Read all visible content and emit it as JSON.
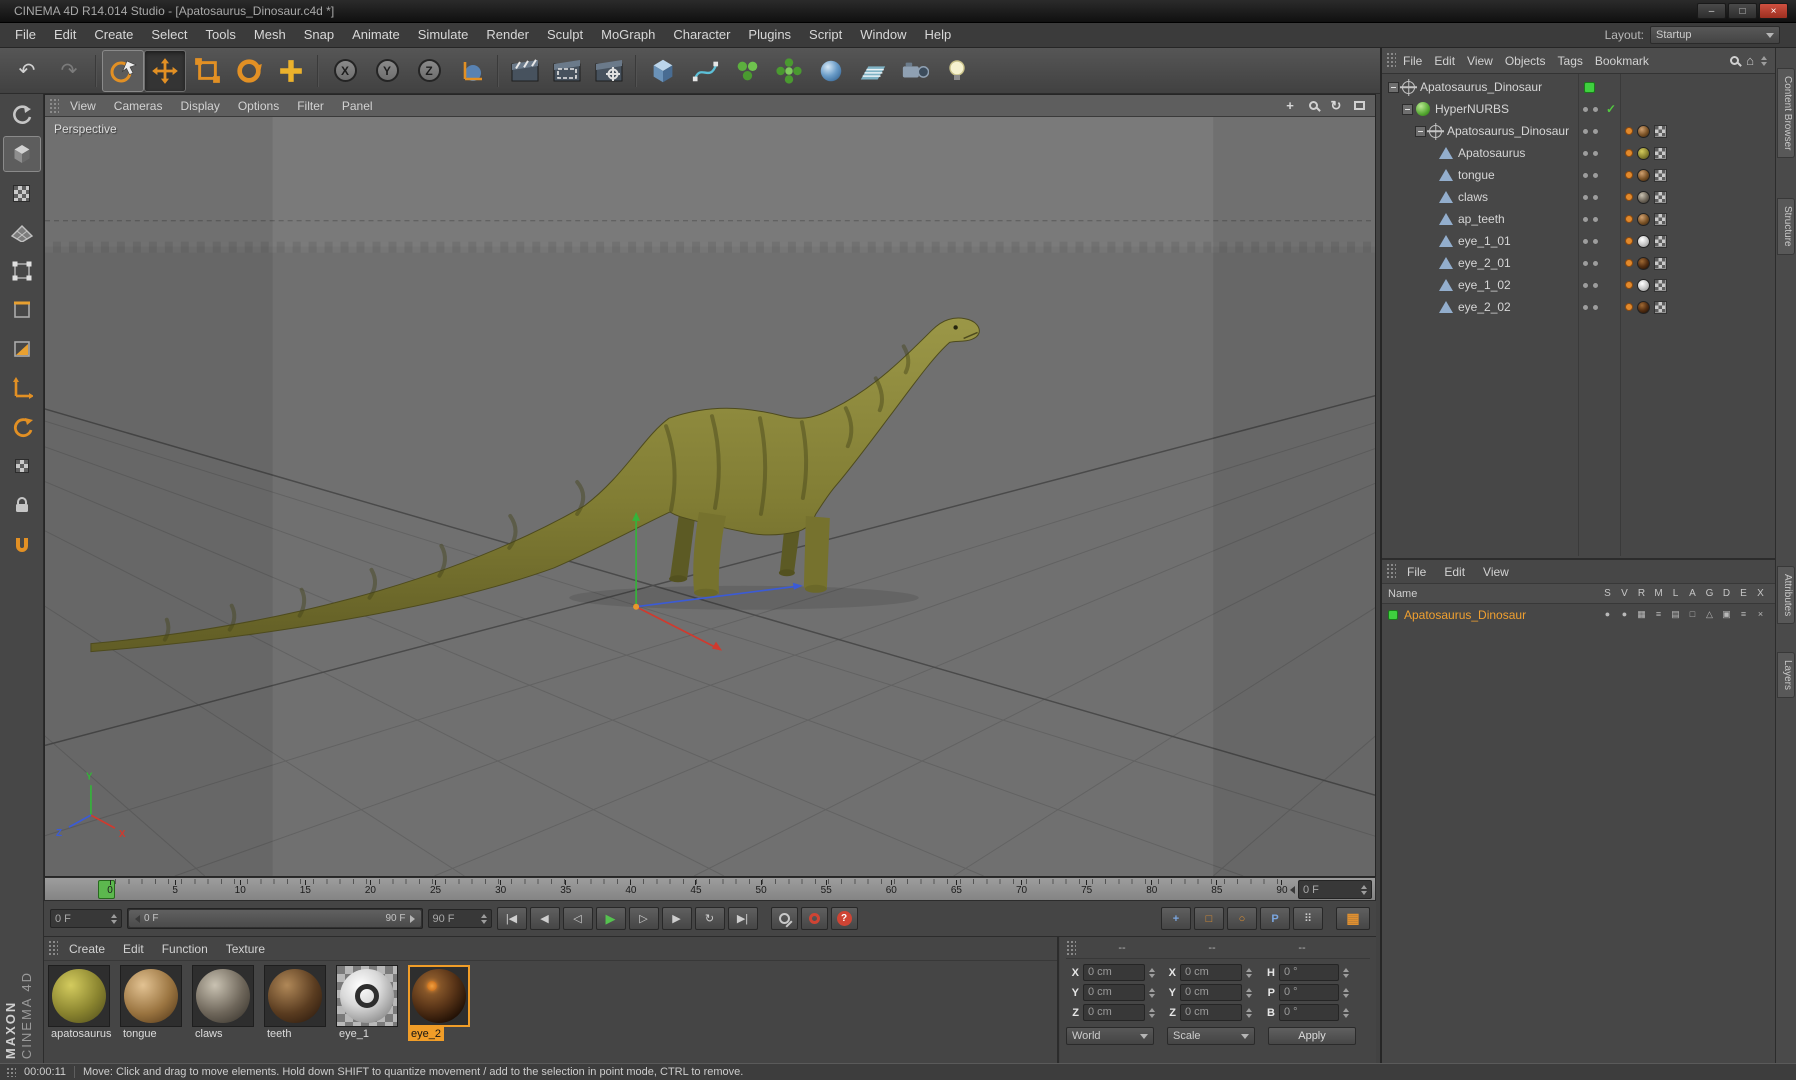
{
  "window": {
    "title": "CINEMA 4D R14.014 Studio - [Apatosaurus_Dinosaur.c4d *]",
    "controls": {
      "minimize": "–",
      "maximize": "□",
      "close": "×"
    }
  },
  "menubar": {
    "items": [
      "File",
      "Edit",
      "Create",
      "Select",
      "Tools",
      "Mesh",
      "Snap",
      "Animate",
      "Simulate",
      "Render",
      "Sculpt",
      "MoGraph",
      "Character",
      "Plugins",
      "Script",
      "Window",
      "Help"
    ],
    "layout_label": "Layout:",
    "layout_value": "Startup"
  },
  "icons": {
    "undo": "↶",
    "redo": "↷",
    "home": "⌂",
    "pan": "+",
    "orbit": "↻"
  },
  "toolbar": {
    "axis_locks": [
      {
        "label": "X",
        "name": "axis-lock-x"
      },
      {
        "label": "Y",
        "name": "axis-lock-y"
      },
      {
        "label": "Z",
        "name": "axis-lock-z"
      }
    ]
  },
  "viewport": {
    "menu": [
      "View",
      "Cameras",
      "Display",
      "Options",
      "Filter",
      "Panel"
    ],
    "label": "Perspective",
    "axis_labels": {
      "x": "X",
      "y": "Y",
      "z": "Z"
    }
  },
  "object_manager": {
    "menu": [
      "File",
      "Edit",
      "View",
      "Objects",
      "Tags",
      "Bookmark"
    ],
    "tree": [
      {
        "label": "Apatosaurus_Dinosaur",
        "depth": 0,
        "icon": "null",
        "expander": true,
        "square": true
      },
      {
        "label": "HyperNURBS",
        "depth": 1,
        "icon": "hypernurbs",
        "expander": true,
        "dots": true,
        "check": "✓"
      },
      {
        "label": "Apatosaurus_Dinosaur",
        "depth": 2,
        "icon": "null",
        "expander": true,
        "dots": true,
        "tags": true,
        "tagvar": "brown"
      },
      {
        "label": "Apatosaurus",
        "depth": 3,
        "icon": "poly",
        "dots": true,
        "tags": true,
        "tagvar": "olive"
      },
      {
        "label": "tongue",
        "depth": 3,
        "icon": "poly",
        "dots": true,
        "tags": true,
        "tagvar": "brown"
      },
      {
        "label": "claws",
        "depth": 3,
        "icon": "poly",
        "dots": true,
        "tags": true,
        "tagvar": "gray"
      },
      {
        "label": "ap_teeth",
        "depth": 3,
        "icon": "poly",
        "dots": true,
        "tags": true,
        "tagvar": "brown"
      },
      {
        "label": "eye_1_01",
        "depth": 3,
        "icon": "poly",
        "dots": true,
        "tags": true,
        "tagvar": "light"
      },
      {
        "label": "eye_2_01",
        "depth": 3,
        "icon": "poly",
        "dots": true,
        "tags": true,
        "tagvar": "dark"
      },
      {
        "label": "eye_1_02",
        "depth": 3,
        "icon": "poly",
        "dots": true,
        "tags": true,
        "tagvar": "light"
      },
      {
        "label": "eye_2_02",
        "depth": 3,
        "icon": "poly",
        "dots": true,
        "tags": true,
        "tagvar": "dark"
      }
    ]
  },
  "layer_panel": {
    "menu": [
      "File",
      "Edit",
      "View"
    ],
    "name_header": "Name",
    "columns": [
      "S",
      "V",
      "R",
      "M",
      "L",
      "A",
      "G",
      "D",
      "E",
      "X"
    ],
    "row": {
      "label": "Apatosaurus_Dinosaur",
      "icons": [
        "●",
        "●",
        "▦",
        "≡",
        "▤",
        "□",
        "△",
        "▣",
        "≡",
        "×"
      ]
    }
  },
  "side_tabs": [
    "Content Browser",
    "Structure",
    "Attributes",
    "Layers"
  ],
  "timeline": {
    "ticks": [
      "0",
      "5",
      "10",
      "15",
      "20",
      "25",
      "30",
      "35",
      "40",
      "45",
      "50",
      "55",
      "60",
      "65",
      "70",
      "75",
      "80",
      "85",
      "90"
    ],
    "frame_field": "0 F"
  },
  "animbar": {
    "start_field": "0 F",
    "range_start": "0 F",
    "range_end": "90 F",
    "end_field": "90 F",
    "transport": [
      {
        "glyph": "|◀",
        "cls": "gray2",
        "name": "goto-start-button"
      },
      {
        "glyph": "◀",
        "cls": "gray2",
        "name": "prev-key-button"
      },
      {
        "glyph": "◁",
        "cls": "gray2",
        "name": "prev-frame-button"
      },
      {
        "glyph": "▶",
        "cls": "green",
        "name": "play-button"
      },
      {
        "glyph": "▷",
        "cls": "gray2",
        "name": "next-frame-button"
      },
      {
        "glyph": "▶",
        "cls": "gray2",
        "name": "next-key-button"
      },
      {
        "glyph": "↻",
        "cls": "gray2",
        "name": "loop-mode-button"
      },
      {
        "glyph": "▶|",
        "cls": "gray2",
        "name": "goto-end-button"
      }
    ],
    "record_q": "?",
    "keytoggles": [
      {
        "glyph": "+",
        "cls": "blue",
        "name": "key-position-toggle"
      },
      {
        "glyph": "□",
        "cls": "orange",
        "name": "key-scale-toggle"
      },
      {
        "glyph": "○",
        "cls": "orange",
        "name": "key-rotation-toggle"
      },
      {
        "glyph": "P",
        "cls": "blue",
        "name": "key-parameter-toggle"
      },
      {
        "glyph": "⠿",
        "cls": "gray2",
        "name": "key-pla-toggle"
      }
    ],
    "grid_glyph": "▦"
  },
  "materials": {
    "menu": [
      "Create",
      "Edit",
      "Function",
      "Texture"
    ],
    "items": [
      {
        "label": "apatosaurus",
        "variant": "olive",
        "selected": false
      },
      {
        "label": "tongue",
        "variant": "tan",
        "selected": false
      },
      {
        "label": "claws",
        "variant": "gray",
        "selected": false
      },
      {
        "label": "teeth",
        "variant": "brown",
        "selected": false
      },
      {
        "label": "eye_1",
        "variant": "light",
        "selected": false
      },
      {
        "label": "eye_2",
        "variant": "dark",
        "selected": true
      }
    ]
  },
  "coords": {
    "header_dashes": [
      "--",
      "--",
      "--"
    ],
    "groups": [
      {
        "rows": [
          {
            "label": "X",
            "value": "0 cm"
          },
          {
            "label": "Y",
            "value": "0 cm"
          },
          {
            "label": "Z",
            "value": "0 cm"
          }
        ]
      },
      {
        "rows": [
          {
            "label": "X",
            "value": "0 cm"
          },
          {
            "label": "Y",
            "value": "0 cm"
          },
          {
            "label": "Z",
            "value": "0 cm"
          }
        ]
      },
      {
        "rows": [
          {
            "label": "H",
            "value": "0 °"
          },
          {
            "label": "P",
            "value": "0 °"
          },
          {
            "label": "B",
            "value": "0 °"
          }
        ]
      }
    ],
    "dropdown1": "World",
    "dropdown2": "Scale",
    "apply": "Apply"
  },
  "statusbar": {
    "time": "00:00:11",
    "message": "Move: Click and drag to move elements. Hold down SHIFT to quantize movement / add to the selection in point mode, CTRL to remove."
  },
  "brand": {
    "line1": "MAXON",
    "line2": "CINEMA 4D"
  }
}
